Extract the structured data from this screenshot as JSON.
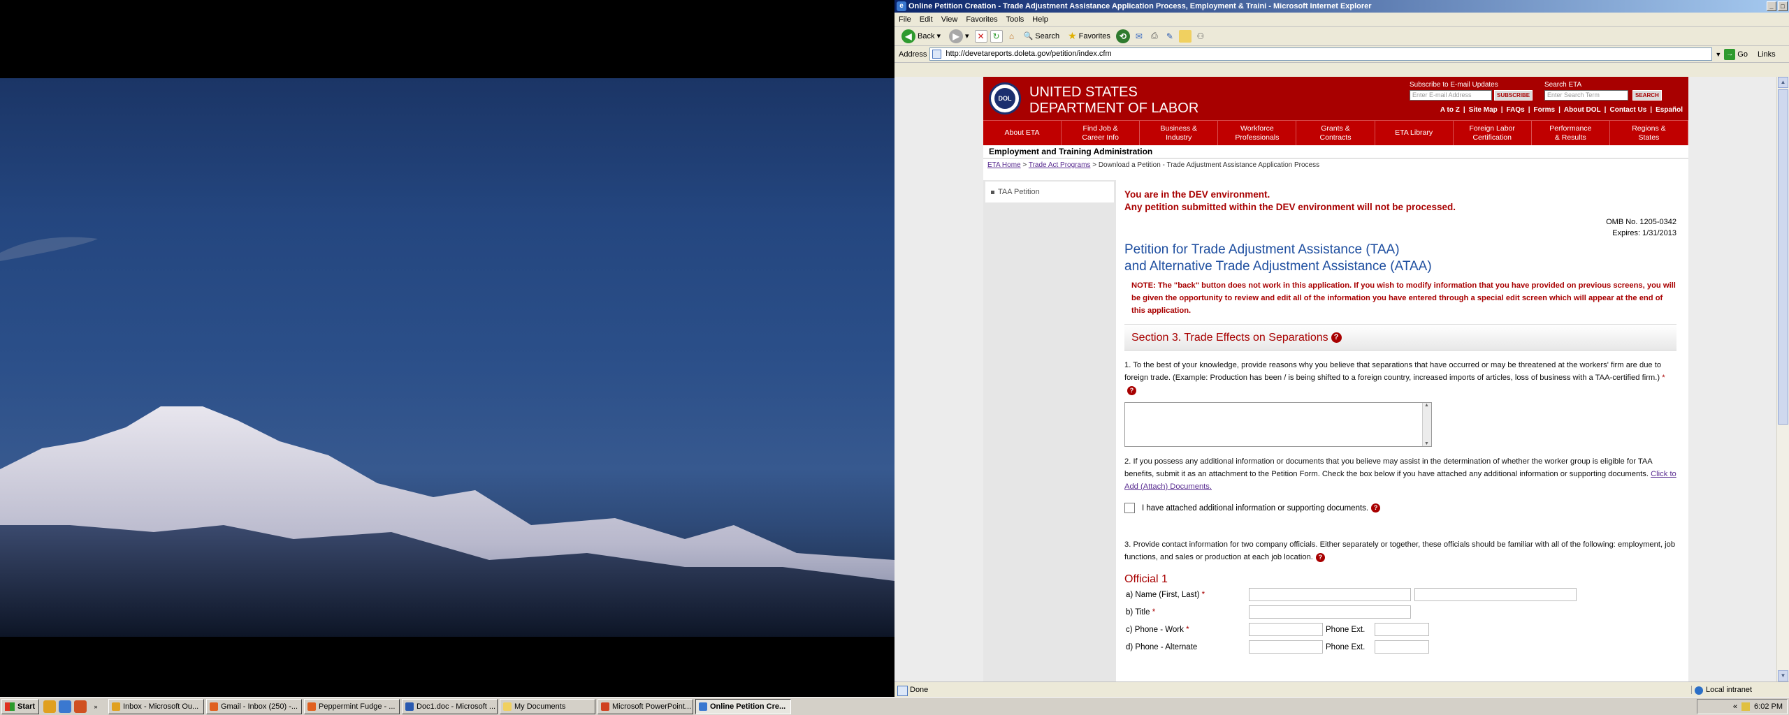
{
  "window": {
    "title": "Online Petition Creation - Trade Adjustment Assistance Application Process, Employment & Traini - Microsoft Internet Explorer",
    "v_label": "V"
  },
  "menu": [
    "File",
    "Edit",
    "View",
    "Favorites",
    "Tools",
    "Help"
  ],
  "toolbar": {
    "back": "Back",
    "search": "Search",
    "favorites": "Favorites"
  },
  "address": {
    "label": "Address",
    "url": "http://devetareports.doleta.gov/petition/index.cfm",
    "go": "Go",
    "links": "Links"
  },
  "dol": {
    "agency_line1": "UNITED STATES",
    "agency_line2": "DEPARTMENT OF LABOR",
    "seal": "DOL",
    "subscribe_prefix": "Subscribe to ",
    "subscribe_link": "E-mail Updates",
    "email_placeholder": "Enter E-mail Address",
    "subscribe_btn": "SUBSCRIBE",
    "search_label": "Search ETA",
    "search_placeholder": "Enter Search Term",
    "search_btn": "SEARCH",
    "toplinks": [
      "A to Z",
      "|",
      "Site Map",
      "|",
      "FAQs",
      "|",
      "Forms",
      "|",
      "About DOL",
      "|",
      "Contact Us",
      "|",
      "Español"
    ],
    "nav": [
      "About ETA",
      "Find Job &\nCareer Info",
      "Business &\nIndustry",
      "Workforce\nProfessionals",
      "Grants &\nContracts",
      "ETA Library",
      "Foreign Labor\nCertification",
      "Performance\n& Results",
      "Regions &\nStates"
    ],
    "eta_bar": "Employment and Training Administration"
  },
  "breadcrumb": {
    "home": "ETA Home",
    "sep1": ">",
    "trade": "Trade Act Programs",
    "sep2": ">",
    "current": "Download a Petition - Trade Adjustment Assistance Application Process"
  },
  "sidebar": {
    "items": [
      "TAA Petition"
    ]
  },
  "main": {
    "dev1": "You are in the DEV environment.",
    "dev2": "Any petition submitted within the DEV environment will not be processed.",
    "omb1": "OMB No. 1205-0342",
    "omb2": "Expires: 1/31/2013",
    "title1": "Petition for Trade Adjustment Assistance (TAA)",
    "title2": "and Alternative Trade Adjustment Assistance (ATAA)",
    "note": "NOTE: The \"back\" button does not work in this application. If you wish to modify information that you have provided on previous screens, you will be given the opportunity to review and edit all of the information you have entered through a special edit screen which will appear at the end of this application.",
    "section": "Section 3. Trade Effects on Separations",
    "q1": "1. To the best of your knowledge, provide reasons why you believe that separations that have occurred or may be threatened at the workers' firm are due to foreign trade. (Example: Production has been / is being shifted to a foreign country, increased imports of articles, loss of business with a TAA-certified firm.)",
    "q2": "2. If you possess any additional information or documents that you believe may assist in the determination of whether the worker group is eligible for TAA benefits, submit it as an attachment to the Petition Form. Check the box below if you have attached any additional information or supporting documents.",
    "q2_link": "Click to Add (Attach) Documents.",
    "checkbox_label": "I have attached additional information or supporting documents.",
    "q3": "3. Provide contact information for two company officials. Either separately or together, these officials should be familiar with all of the following: employment, job functions, and sales or production at each job location.",
    "official": "Official 1",
    "fields": {
      "name": "a) Name (First, Last)",
      "title": "b) Title",
      "phone_work": "c) Phone - Work",
      "phone_alt": "d) Phone - Alternate",
      "ext": "Phone Ext."
    },
    "asterisk": "*",
    "help": "?"
  },
  "status": {
    "text": "Done",
    "zone": "Local intranet"
  },
  "taskbar": {
    "start": "Start",
    "tasks": [
      "Inbox - Microsoft Ou...",
      "Gmail - Inbox (250) -...",
      "Peppermint Fudge - ...",
      "Doc1.doc - Microsoft ...",
      "My Documents",
      "Microsoft PowerPoint...",
      "Online Petition Cre..."
    ],
    "clock": "6:02 PM",
    "more": "»"
  },
  "colors": {
    "dol_red": "#a80000",
    "title_blue": "#1f4fa0",
    "xp_title": "#0a246a"
  }
}
